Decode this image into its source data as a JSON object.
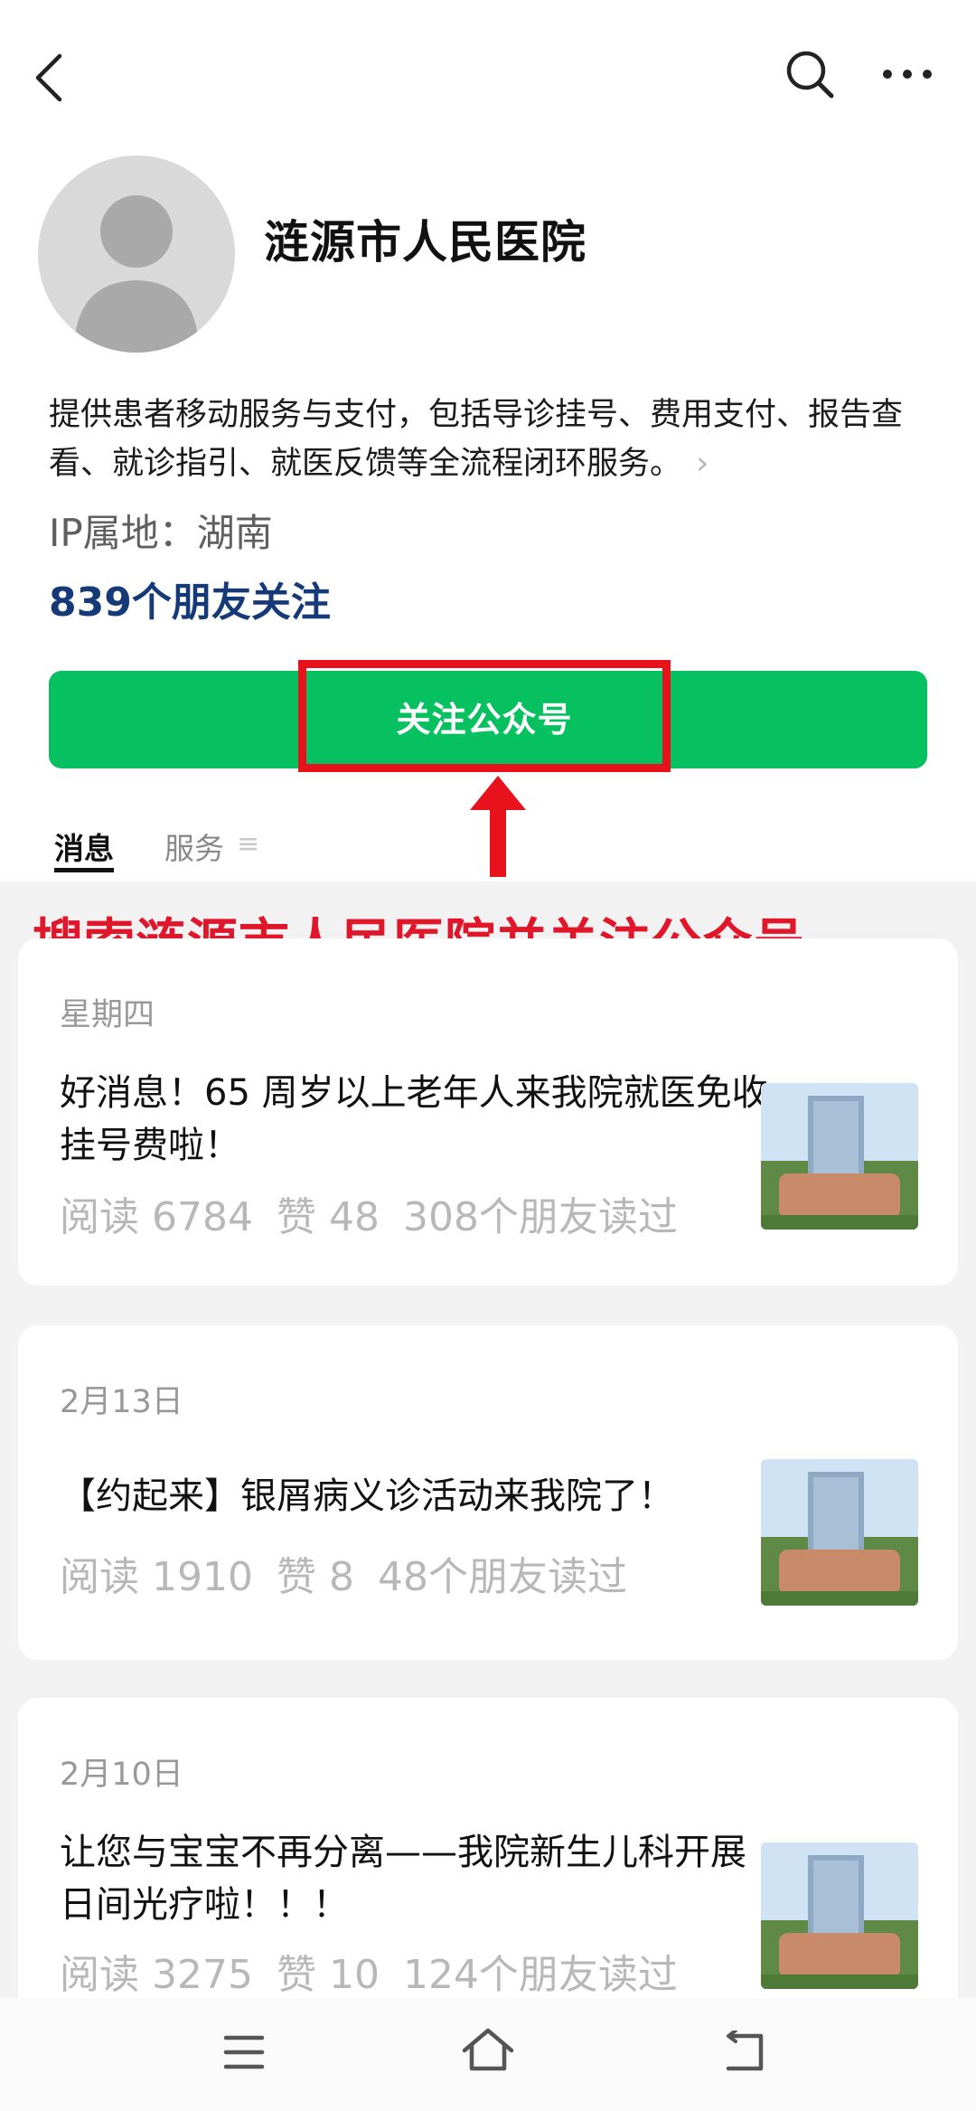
{
  "header": {
    "back_icon": "back-icon",
    "search_icon": "search-icon",
    "more_icon": "more-icon"
  },
  "profile": {
    "name": "涟源市人民医院",
    "description": "提供患者移动服务与支付，包括导诊挂号、费用支付、报告查看、就诊指引、就医反馈等全流程闭环服务。",
    "description_arrow": "›",
    "ip_location": "IP属地：湖南",
    "friends_following": "839个朋友关注"
  },
  "follow_button": {
    "label": "关注公众号",
    "color": "#07c160",
    "highlight_color": "#e8121d"
  },
  "tabs": {
    "messages": "消息",
    "services": "服务",
    "services_icon": "≡"
  },
  "annotation": {
    "text": "搜索涟源市人民医院并关注公众号",
    "color": "#e0162b"
  },
  "articles": [
    {
      "date": "星期四",
      "title": "好消息！65 周岁以上老年人来我院就医免收挂号费啦！",
      "reads": "阅读 6784",
      "likes": "赞 48",
      "friends_read": "308个朋友读过"
    },
    {
      "date": "2月13日",
      "title": "【约起来】银屑病义诊活动来我院了！",
      "reads": "阅读 1910",
      "likes": "赞 8",
      "friends_read": "48个朋友读过"
    },
    {
      "date": "2月10日",
      "title": "让您与宝宝不再分离——我院新生儿科开展日间光疗啦！！！",
      "reads": "阅读 3275",
      "likes": "赞 10",
      "friends_read": "124个朋友读过"
    }
  ],
  "bottom_nav": {
    "menu_icon": "menu-icon",
    "home_icon": "home-icon",
    "back_icon": "back-nav-icon"
  }
}
